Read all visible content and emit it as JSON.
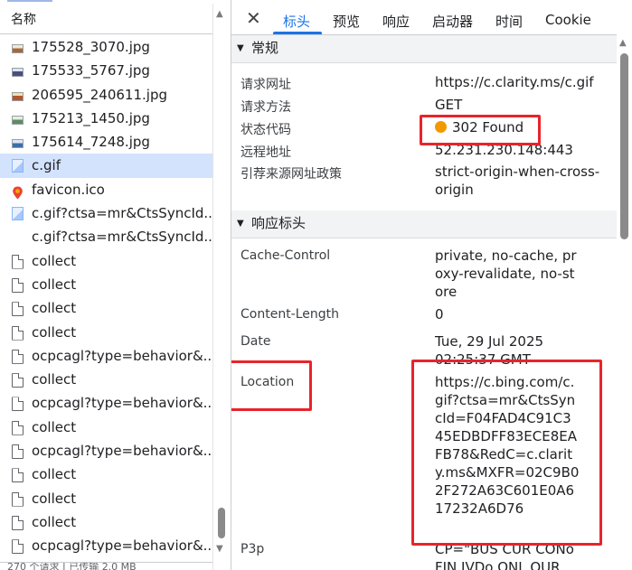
{
  "request_list": {
    "column_header": "名称",
    "rows": [
      {
        "name": "175528_3070.jpg",
        "icon": "image-icon"
      },
      {
        "name": "175533_5767.jpg",
        "icon": "image-icon"
      },
      {
        "name": "206595_240611.jpg",
        "icon": "image-icon"
      },
      {
        "name": "175213_1450.jpg",
        "icon": "image-icon"
      },
      {
        "name": "175614_7248.jpg",
        "icon": "image-icon"
      },
      {
        "name": "c.gif",
        "icon": "gif-icon",
        "selected": true
      },
      {
        "name": "favicon.ico",
        "icon": "favicon-icon"
      },
      {
        "name": "c.gif?ctsa=mr&CtsSyncId...",
        "icon": "gif-icon"
      },
      {
        "name": "c.gif?ctsa=mr&CtsSyncId...",
        "icon": "none"
      },
      {
        "name": "collect",
        "icon": "document-icon"
      },
      {
        "name": "collect",
        "icon": "document-icon"
      },
      {
        "name": "collect",
        "icon": "document-icon"
      },
      {
        "name": "collect",
        "icon": "document-icon"
      },
      {
        "name": "ocpcagl?type=behavior&...",
        "icon": "document-icon"
      },
      {
        "name": "collect",
        "icon": "document-icon"
      },
      {
        "name": "ocpcagl?type=behavior&...",
        "icon": "document-icon"
      },
      {
        "name": "collect",
        "icon": "document-icon"
      },
      {
        "name": "ocpcagl?type=behavior&...",
        "icon": "document-icon"
      },
      {
        "name": "collect",
        "icon": "document-icon"
      },
      {
        "name": "collect",
        "icon": "document-icon"
      },
      {
        "name": "collect",
        "icon": "document-icon"
      },
      {
        "name": "ocpcagl?type=behavior&...",
        "icon": "document-icon"
      }
    ],
    "footer": "270 个请求 | 已传输 2.0 MB"
  },
  "detail_tabs": {
    "close": "✕",
    "tabs": [
      "标头",
      "预览",
      "响应",
      "启动器",
      "时间",
      "Cookie"
    ],
    "active": "标头"
  },
  "general": {
    "title": "常规",
    "rows": [
      {
        "key": "请求网址",
        "value": "https://c.clarity.ms/c.gif"
      },
      {
        "key": "请求方法",
        "value": "GET"
      },
      {
        "key": "状态代码",
        "value": "302 Found"
      },
      {
        "key": "远程地址",
        "value": "52.231.230.148:443"
      },
      {
        "key": "引荐来源网址政策",
        "value": "strict-origin-when-cross-origin"
      }
    ]
  },
  "response_headers": {
    "title": "响应标头",
    "rows": [
      {
        "key": "Cache-Control",
        "value": "private, no-cache, proxy-revalidate, no-store"
      },
      {
        "key": "Content-Length",
        "value": "0"
      },
      {
        "key": "Date",
        "value": "Tue, 29 Jul 2025 02:25:37 GMT"
      },
      {
        "key": "Location",
        "value": "https://c.bing.com/c.gif?ctsa=mr&CtsSyncId=F04FAD4C91C345EDBDFF83ECE8EAFB78&RedC=c.clarity.ms&MXFR=02C9B02F272A63C601E0A617232A6D76"
      },
      {
        "key": "P3p",
        "value": "CP=\"BUS CUR CONo FIN IVDo ONL OUR"
      }
    ]
  },
  "colors": {
    "accent": "#1a73e8",
    "selected_row": "#d3e3fd",
    "status_dot": "#f29900",
    "highlight_box": "#e8242a"
  }
}
